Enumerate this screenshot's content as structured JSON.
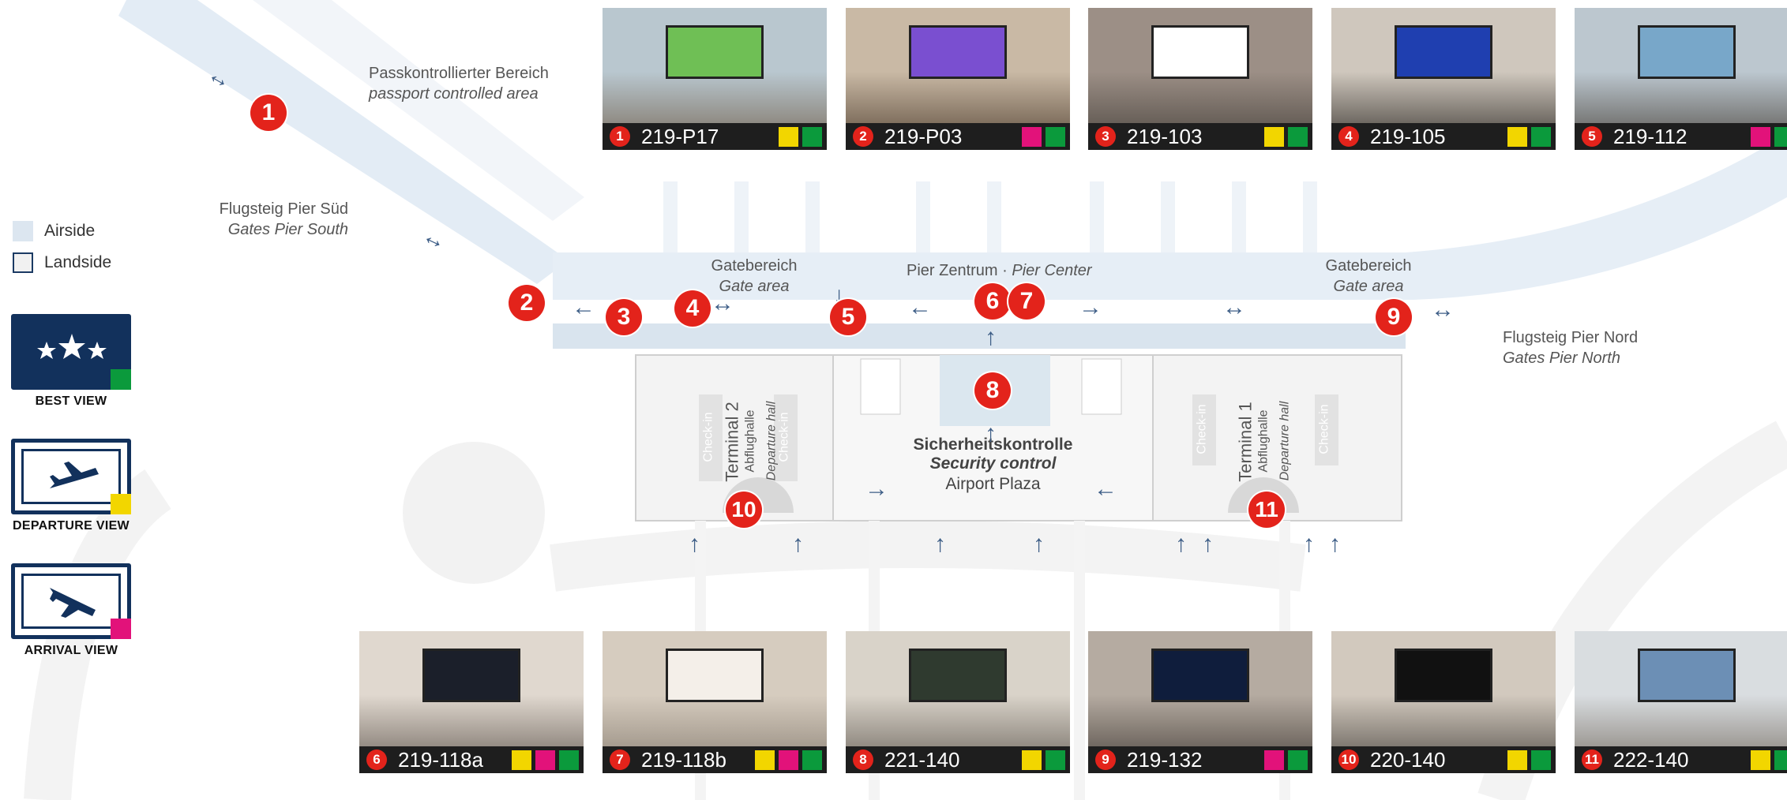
{
  "legend": {
    "airside": "Airside",
    "landside": "Landside",
    "best_view": "BEST VIEW",
    "departure_view": "DEPARTURE VIEW",
    "arrival_view": "ARRIVAL VIEW",
    "colors": {
      "navy": "#12315c",
      "best": "#0b9a3c",
      "departure": "#f2d600",
      "arrival": "#e2127a",
      "marker": "#e3231b"
    }
  },
  "labels": {
    "passport_de": "Passkontrollierter Bereich",
    "passport_en": "passport controlled area",
    "pier_south_de": "Flugsteig Pier Süd",
    "pier_south_en": "Gates Pier South",
    "gate_area_left_de": "Gatebereich",
    "gate_area_left_en": "Gate area",
    "pier_center_de": "Pier Zentrum ·",
    "pier_center_en": "Pier Center",
    "gate_area_right_de": "Gatebereich",
    "gate_area_right_en": "Gate area",
    "pier_north_de": "Flugsteig Pier Nord",
    "pier_north_en": "Gates Pier North",
    "terminal2": "Terminal 2",
    "terminal1": "Terminal 1",
    "departure_hall_de": "Abflughalle",
    "departure_hall_en": "Departure hall",
    "checkin": "Check-in",
    "security_de": "Sicherheitskontrolle",
    "security_en": "Security control",
    "airport_plaza": "Airport Plaza"
  },
  "markers": [
    "1",
    "2",
    "3",
    "4",
    "5",
    "6",
    "7",
    "8",
    "9",
    "10",
    "11"
  ],
  "tiles": [
    {
      "num": "1",
      "code": "219-P17",
      "views": [
        "departure",
        "best"
      ]
    },
    {
      "num": "2",
      "code": "219-P03",
      "views": [
        "arrival",
        "best"
      ]
    },
    {
      "num": "3",
      "code": "219-103",
      "views": [
        "departure",
        "best"
      ]
    },
    {
      "num": "4",
      "code": "219-105",
      "views": [
        "departure",
        "best"
      ]
    },
    {
      "num": "5",
      "code": "219-112",
      "views": [
        "arrival",
        "best"
      ]
    },
    {
      "num": "6",
      "code": "219-118a",
      "views": [
        "departure",
        "arrival",
        "best"
      ]
    },
    {
      "num": "7",
      "code": "219-118b",
      "views": [
        "departure",
        "arrival",
        "best"
      ]
    },
    {
      "num": "8",
      "code": "221-140",
      "views": [
        "departure",
        "best"
      ]
    },
    {
      "num": "9",
      "code": "219-132",
      "views": [
        "arrival",
        "best"
      ]
    },
    {
      "num": "10",
      "code": "220-140",
      "views": [
        "departure",
        "best"
      ]
    },
    {
      "num": "11",
      "code": "222-140",
      "views": [
        "departure",
        "best"
      ]
    }
  ]
}
